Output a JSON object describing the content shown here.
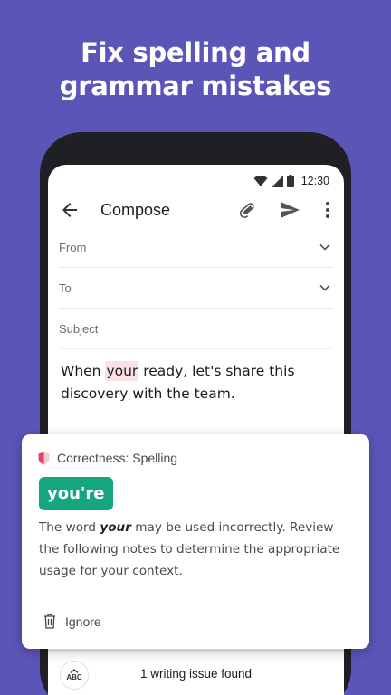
{
  "headline": {
    "line1": "Fix spelling and",
    "line2": "grammar mistakes"
  },
  "colors": {
    "background": "#5b55b8",
    "accent": "#15a67f",
    "highlight": "#fbe1e6",
    "correctness": "#e0455f"
  },
  "status_bar": {
    "time": "12:30",
    "icons": [
      "wifi-icon",
      "signal-icon",
      "battery-icon"
    ]
  },
  "toolbar": {
    "title": "Compose",
    "icons": [
      "back-arrow-icon",
      "attachment-icon",
      "send-icon",
      "more-vert-icon"
    ]
  },
  "fields": {
    "from_label": "From",
    "to_label": "To",
    "subject_label": "Subject"
  },
  "email_body": {
    "before": "When ",
    "flagged_word": "your",
    "after": " ready, let's share this discovery with the team."
  },
  "card": {
    "category": "Correctness: Spelling",
    "suggestion": "you're",
    "explanation_before": "The word ",
    "explanation_word": "your",
    "explanation_after": " may be used incorrectly. Review the following notes to determine the appropriate usage for your context.",
    "ignore_label": "Ignore"
  },
  "bottom_bar": {
    "abc_label": "ABC",
    "issue_count": "1 writing issue found"
  }
}
